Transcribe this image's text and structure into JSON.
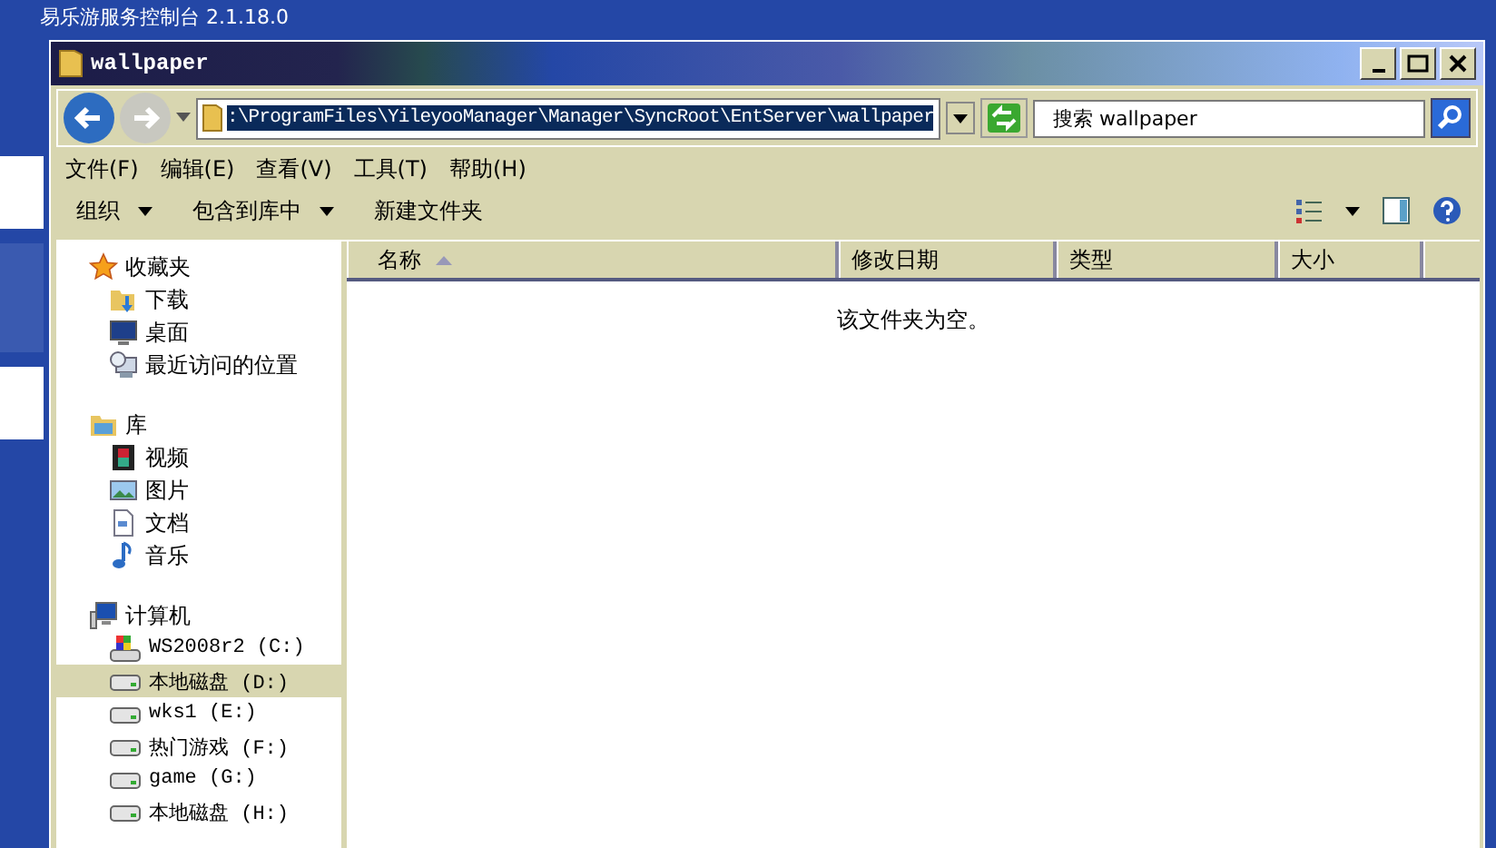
{
  "background_app": {
    "title": "易乐游服务控制台 2.1.18.0"
  },
  "window": {
    "title": "wallpaper"
  },
  "address_bar": {
    "path": ":\\ProgramFiles\\YileyooManager\\Manager\\SyncRoot\\EntServer\\wallpaper"
  },
  "search": {
    "placeholder": "搜索 wallpaper"
  },
  "menu": [
    "文件(F)",
    "编辑(E)",
    "查看(V)",
    "工具(T)",
    "帮助(H)"
  ],
  "toolbar": [
    {
      "label": "组织",
      "dropdown": true
    },
    {
      "label": "包含到库中",
      "dropdown": true
    },
    {
      "label": "新建文件夹",
      "dropdown": false
    }
  ],
  "sidebar": {
    "groups": [
      {
        "label": "收藏夹",
        "kind": "star",
        "items": [
          {
            "label": "下载",
            "kind": "download",
            "selected": false
          },
          {
            "label": "桌面",
            "kind": "desktop",
            "selected": false
          },
          {
            "label": "最近访问的位置",
            "kind": "recent",
            "selected": false
          }
        ]
      },
      {
        "label": "库",
        "kind": "library",
        "items": [
          {
            "label": "视频",
            "kind": "video",
            "selected": false
          },
          {
            "label": "图片",
            "kind": "picture",
            "selected": false
          },
          {
            "label": "文档",
            "kind": "document",
            "selected": false
          },
          {
            "label": "音乐",
            "kind": "music",
            "selected": false
          }
        ]
      },
      {
        "label": "计算机",
        "kind": "computer",
        "items": [
          {
            "label": "WS2008r2 (C:)",
            "kind": "osdrive",
            "selected": false
          },
          {
            "label": "本地磁盘 (D:)",
            "kind": "drive",
            "selected": true
          },
          {
            "label": "wks1 (E:)",
            "kind": "drive",
            "selected": false
          },
          {
            "label": "热门游戏 (F:)",
            "kind": "drive",
            "selected": false
          },
          {
            "label": "game (G:)",
            "kind": "drive",
            "selected": false
          },
          {
            "label": "本地磁盘 (H:)",
            "kind": "drive",
            "selected": false
          }
        ]
      }
    ]
  },
  "table": {
    "columns": [
      {
        "label": "名称",
        "sorted": true
      },
      {
        "label": "修改日期",
        "sorted": false
      },
      {
        "label": "类型",
        "sorted": false
      },
      {
        "label": "大小",
        "sorted": false
      }
    ],
    "empty_message": "该文件夹为空。"
  }
}
